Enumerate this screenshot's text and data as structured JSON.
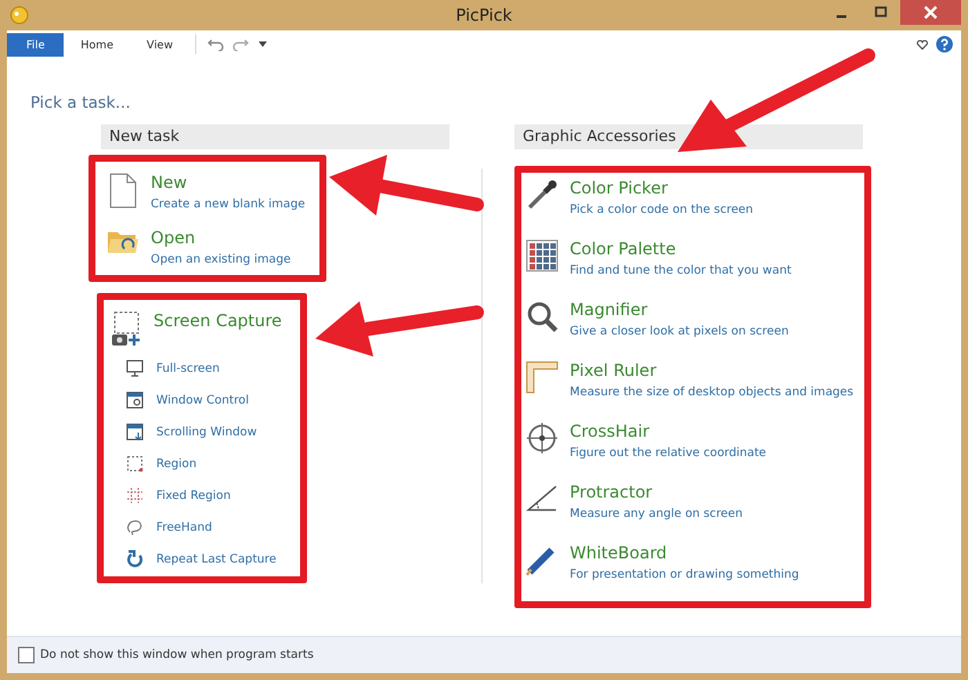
{
  "window": {
    "title": "PicPick"
  },
  "ribbon": {
    "tabs": [
      {
        "label": "File",
        "selected": true
      },
      {
        "label": "Home",
        "selected": false
      },
      {
        "label": "View",
        "selected": false
      }
    ]
  },
  "heading": "Pick a task...",
  "new_task": {
    "header": "New task",
    "items": [
      {
        "title": "New",
        "description": "Create a new blank image"
      },
      {
        "title": "Open",
        "description": "Open an existing image"
      }
    ]
  },
  "screen_capture": {
    "title": "Screen Capture",
    "items": [
      "Full-screen",
      "Window Control",
      "Scrolling Window",
      "Region",
      "Fixed Region",
      "FreeHand",
      "Repeat Last Capture"
    ]
  },
  "graphic_accessories": {
    "header": "Graphic Accessories",
    "items": [
      {
        "title": "Color Picker",
        "description": "Pick a color code on the screen"
      },
      {
        "title": "Color Palette",
        "description": "Find and tune the color that you want"
      },
      {
        "title": "Magnifier",
        "description": "Give a closer look at pixels on screen"
      },
      {
        "title": "Pixel Ruler",
        "description": "Measure the size of desktop objects and images"
      },
      {
        "title": "CrossHair",
        "description": "Figure out the relative coordinate"
      },
      {
        "title": "Protractor",
        "description": "Measure any angle on screen"
      },
      {
        "title": "WhiteBoard",
        "description": "For presentation or drawing something"
      }
    ]
  },
  "footer": {
    "checkbox": {
      "label": "Do not show this window when program starts",
      "checked": false
    }
  }
}
